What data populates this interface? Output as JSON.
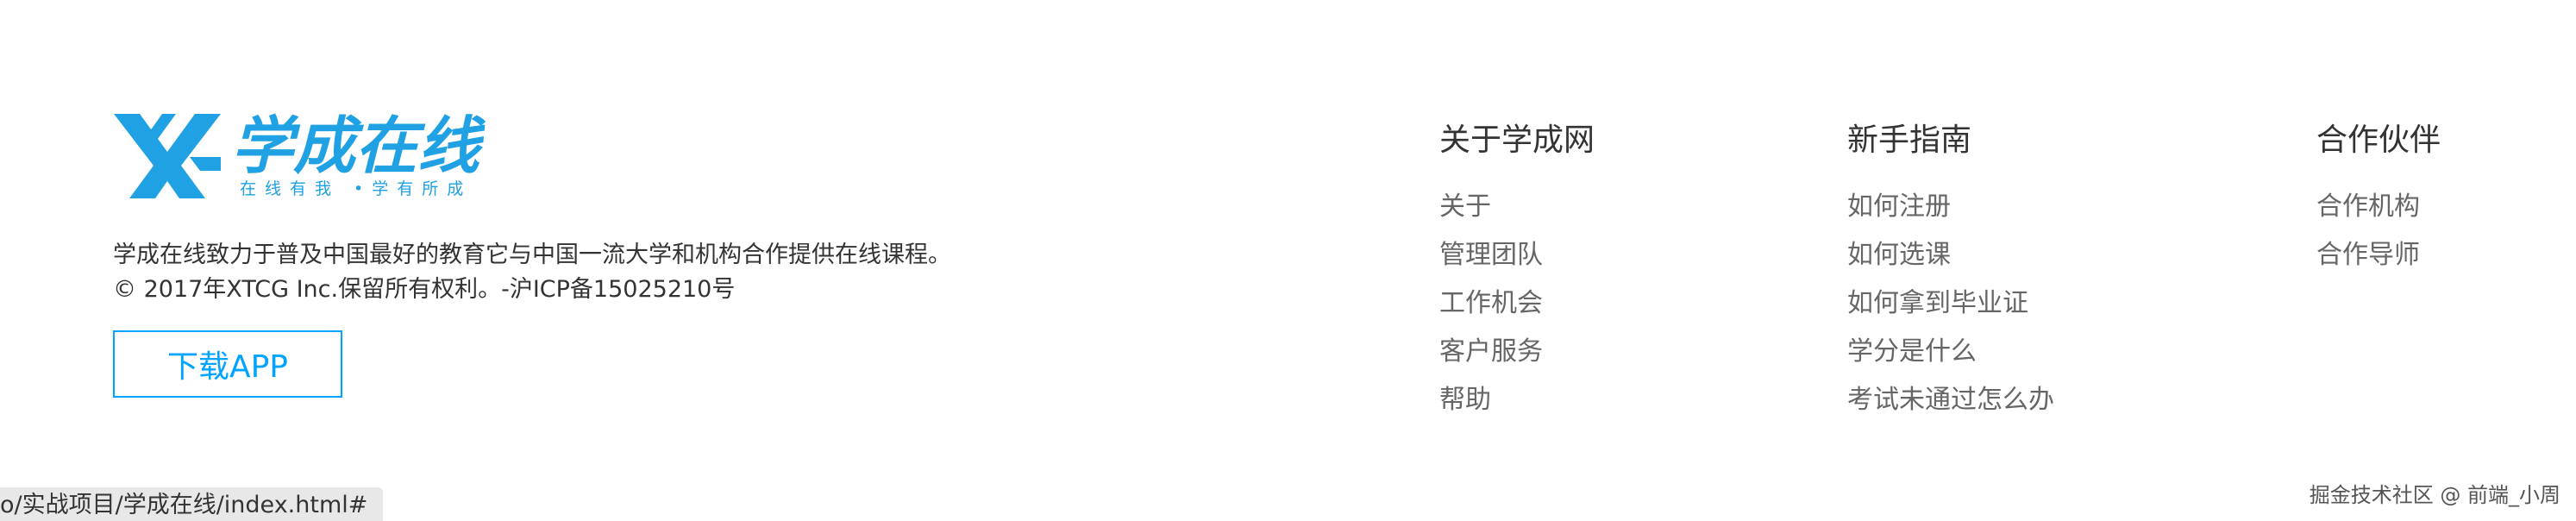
{
  "logo": {
    "name": "学成在线",
    "slogan": "在线有我 •学有所成",
    "brand_color": "#1fa1e3"
  },
  "about": {
    "line1": "学成在线致力于普及中国最好的教育它与中国一流大学和机构合作提供在线课程。",
    "line2": "© 2017年XTCG Inc.保留所有权利。-沪ICP备15025210号"
  },
  "download_button": {
    "label": "下载APP",
    "color": "#00a4ff"
  },
  "columns": [
    {
      "title": "关于学成网",
      "links": [
        "关于",
        "管理团队",
        "工作机会",
        "客户服务",
        "帮助"
      ]
    },
    {
      "title": "新手指南",
      "links": [
        "如何注册",
        "如何选课",
        "如何拿到毕业证",
        "学分是什么",
        "考试未通过怎么办"
      ]
    },
    {
      "title": "合作伙伴",
      "links": [
        "合作机构",
        "合作导师"
      ]
    }
  ],
  "status_bar": {
    "url": "o/实战项目/学成在线/index.html#"
  },
  "watermark": {
    "text": "掘金技术社区 @ 前端_小周"
  }
}
